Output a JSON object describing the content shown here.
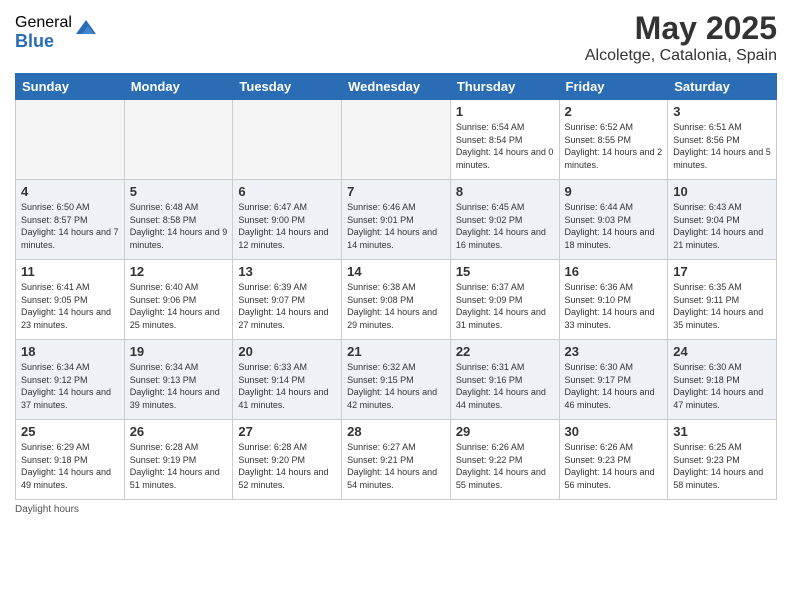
{
  "header": {
    "logo_general": "General",
    "logo_blue": "Blue",
    "month": "May 2025",
    "location": "Alcoletge, Catalonia, Spain"
  },
  "days_of_week": [
    "Sunday",
    "Monday",
    "Tuesday",
    "Wednesday",
    "Thursday",
    "Friday",
    "Saturday"
  ],
  "weeks": [
    [
      {
        "day": "",
        "empty": true
      },
      {
        "day": "",
        "empty": true
      },
      {
        "day": "",
        "empty": true
      },
      {
        "day": "",
        "empty": true
      },
      {
        "day": "1",
        "sunrise": "6:54 AM",
        "sunset": "8:54 PM",
        "daylight": "14 hours and 0 minutes."
      },
      {
        "day": "2",
        "sunrise": "6:52 AM",
        "sunset": "8:55 PM",
        "daylight": "14 hours and 2 minutes."
      },
      {
        "day": "3",
        "sunrise": "6:51 AM",
        "sunset": "8:56 PM",
        "daylight": "14 hours and 5 minutes."
      }
    ],
    [
      {
        "day": "4",
        "sunrise": "6:50 AM",
        "sunset": "8:57 PM",
        "daylight": "14 hours and 7 minutes."
      },
      {
        "day": "5",
        "sunrise": "6:48 AM",
        "sunset": "8:58 PM",
        "daylight": "14 hours and 9 minutes."
      },
      {
        "day": "6",
        "sunrise": "6:47 AM",
        "sunset": "9:00 PM",
        "daylight": "14 hours and 12 minutes."
      },
      {
        "day": "7",
        "sunrise": "6:46 AM",
        "sunset": "9:01 PM",
        "daylight": "14 hours and 14 minutes."
      },
      {
        "day": "8",
        "sunrise": "6:45 AM",
        "sunset": "9:02 PM",
        "daylight": "14 hours and 16 minutes."
      },
      {
        "day": "9",
        "sunrise": "6:44 AM",
        "sunset": "9:03 PM",
        "daylight": "14 hours and 18 minutes."
      },
      {
        "day": "10",
        "sunrise": "6:43 AM",
        "sunset": "9:04 PM",
        "daylight": "14 hours and 21 minutes."
      }
    ],
    [
      {
        "day": "11",
        "sunrise": "6:41 AM",
        "sunset": "9:05 PM",
        "daylight": "14 hours and 23 minutes."
      },
      {
        "day": "12",
        "sunrise": "6:40 AM",
        "sunset": "9:06 PM",
        "daylight": "14 hours and 25 minutes."
      },
      {
        "day": "13",
        "sunrise": "6:39 AM",
        "sunset": "9:07 PM",
        "daylight": "14 hours and 27 minutes."
      },
      {
        "day": "14",
        "sunrise": "6:38 AM",
        "sunset": "9:08 PM",
        "daylight": "14 hours and 29 minutes."
      },
      {
        "day": "15",
        "sunrise": "6:37 AM",
        "sunset": "9:09 PM",
        "daylight": "14 hours and 31 minutes."
      },
      {
        "day": "16",
        "sunrise": "6:36 AM",
        "sunset": "9:10 PM",
        "daylight": "14 hours and 33 minutes."
      },
      {
        "day": "17",
        "sunrise": "6:35 AM",
        "sunset": "9:11 PM",
        "daylight": "14 hours and 35 minutes."
      }
    ],
    [
      {
        "day": "18",
        "sunrise": "6:34 AM",
        "sunset": "9:12 PM",
        "daylight": "14 hours and 37 minutes."
      },
      {
        "day": "19",
        "sunrise": "6:34 AM",
        "sunset": "9:13 PM",
        "daylight": "14 hours and 39 minutes."
      },
      {
        "day": "20",
        "sunrise": "6:33 AM",
        "sunset": "9:14 PM",
        "daylight": "14 hours and 41 minutes."
      },
      {
        "day": "21",
        "sunrise": "6:32 AM",
        "sunset": "9:15 PM",
        "daylight": "14 hours and 42 minutes."
      },
      {
        "day": "22",
        "sunrise": "6:31 AM",
        "sunset": "9:16 PM",
        "daylight": "14 hours and 44 minutes."
      },
      {
        "day": "23",
        "sunrise": "6:30 AM",
        "sunset": "9:17 PM",
        "daylight": "14 hours and 46 minutes."
      },
      {
        "day": "24",
        "sunrise": "6:30 AM",
        "sunset": "9:18 PM",
        "daylight": "14 hours and 47 minutes."
      }
    ],
    [
      {
        "day": "25",
        "sunrise": "6:29 AM",
        "sunset": "9:18 PM",
        "daylight": "14 hours and 49 minutes."
      },
      {
        "day": "26",
        "sunrise": "6:28 AM",
        "sunset": "9:19 PM",
        "daylight": "14 hours and 51 minutes."
      },
      {
        "day": "27",
        "sunrise": "6:28 AM",
        "sunset": "9:20 PM",
        "daylight": "14 hours and 52 minutes."
      },
      {
        "day": "28",
        "sunrise": "6:27 AM",
        "sunset": "9:21 PM",
        "daylight": "14 hours and 54 minutes."
      },
      {
        "day": "29",
        "sunrise": "6:26 AM",
        "sunset": "9:22 PM",
        "daylight": "14 hours and 55 minutes."
      },
      {
        "day": "30",
        "sunrise": "6:26 AM",
        "sunset": "9:23 PM",
        "daylight": "14 hours and 56 minutes."
      },
      {
        "day": "31",
        "sunrise": "6:25 AM",
        "sunset": "9:23 PM",
        "daylight": "14 hours and 58 minutes."
      }
    ]
  ],
  "footer": {
    "daylight_label": "Daylight hours"
  }
}
